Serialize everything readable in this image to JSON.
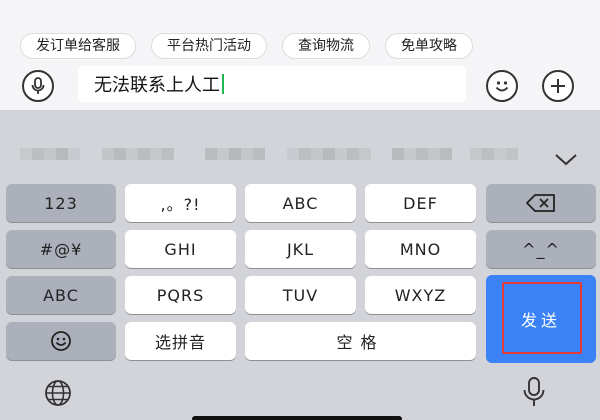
{
  "quick_replies": [
    "发订单给客服",
    "平台热门活动",
    "查询物流",
    "免单攻略"
  ],
  "message_input": {
    "value": "无法联系上人工"
  },
  "icons": {
    "voice": "microphone-icon",
    "emoji": "smiley-icon",
    "plus": "plus-icon",
    "chevron": "chevron-down-icon",
    "backspace": "backspace-icon",
    "emoticon_key": "emoticon-icon",
    "emoji_key": "emoji-icon",
    "globe": "globe-icon",
    "dictation": "microphone-icon"
  },
  "keyboard": {
    "left_col": [
      "123",
      "#@¥",
      "ABC"
    ],
    "row1": [
      ",。?!",
      "ABC",
      "DEF"
    ],
    "row2": [
      "GHI",
      "JKL",
      "MNO"
    ],
    "row3": [
      "PQRS",
      "TUV",
      "WXYZ"
    ],
    "pinyin": "选拼音",
    "space": "空格",
    "send": "发送",
    "emoticon": "^_^"
  },
  "colors": {
    "send_bg": "#3b82f6",
    "highlight_border": "#e63a3a",
    "caret": "#1db954"
  }
}
